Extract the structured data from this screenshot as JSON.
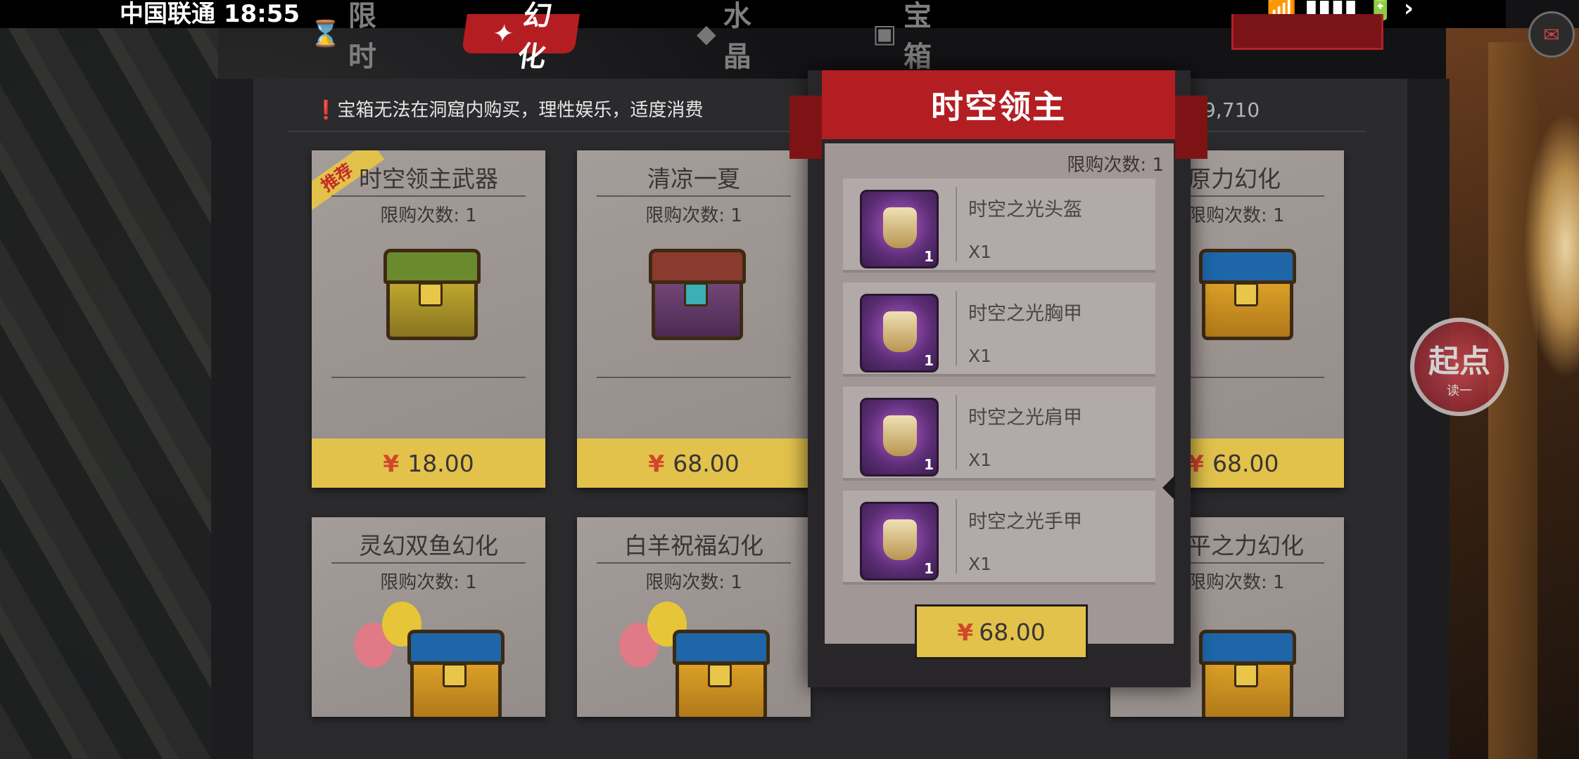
{
  "status": {
    "carrier": "中国联通 18:55",
    "right": "📶 ▮▮▮▮ 🔋 ›"
  },
  "tabs": [
    {
      "label": "限时",
      "active": false
    },
    {
      "label": "幻化",
      "active": true
    },
    {
      "label": "水晶",
      "active": false
    },
    {
      "label": "宝箱",
      "active": false
    }
  ],
  "notice": "宝箱无法在洞窟内购买，理性娱乐，适度消费",
  "notice_mark": "❗",
  "currency": "9,710",
  "currency_symbol": "¥",
  "cards": [
    {
      "title": "时空领主武器",
      "limit": "限购次数: 1",
      "price": "18.00",
      "tag": "推荐"
    },
    {
      "title": "清凉一夏",
      "limit": "限购次数: 1",
      "price": "68.00"
    },
    {
      "title": "原力幻化",
      "limit": "限购次数: 1",
      "price": "68.00"
    },
    {
      "title": "灵幻双鱼幻化",
      "limit": "限购次数: 1"
    },
    {
      "title": "白羊祝福幻化",
      "limit": "限购次数: 1"
    },
    {
      "title": "平之力幻化",
      "limit": "限购次数: 1"
    }
  ],
  "popup": {
    "title": "时空领主",
    "limit": "限购次数: 1",
    "items": [
      {
        "name": "时空之光头盔",
        "count": "X1",
        "qty": "1"
      },
      {
        "name": "时空之光胸甲",
        "count": "X1",
        "qty": "1"
      },
      {
        "name": "时空之光肩甲",
        "count": "X1",
        "qty": "1"
      },
      {
        "name": "时空之光手甲",
        "count": "X1",
        "qty": "1"
      }
    ],
    "price": "68.00"
  },
  "badge": {
    "t1": "起点",
    "t2": "读一"
  },
  "colors": {
    "accent_red": "#b31e22",
    "price_yellow": "#e2c24b",
    "card_gray": "#a49c99"
  }
}
